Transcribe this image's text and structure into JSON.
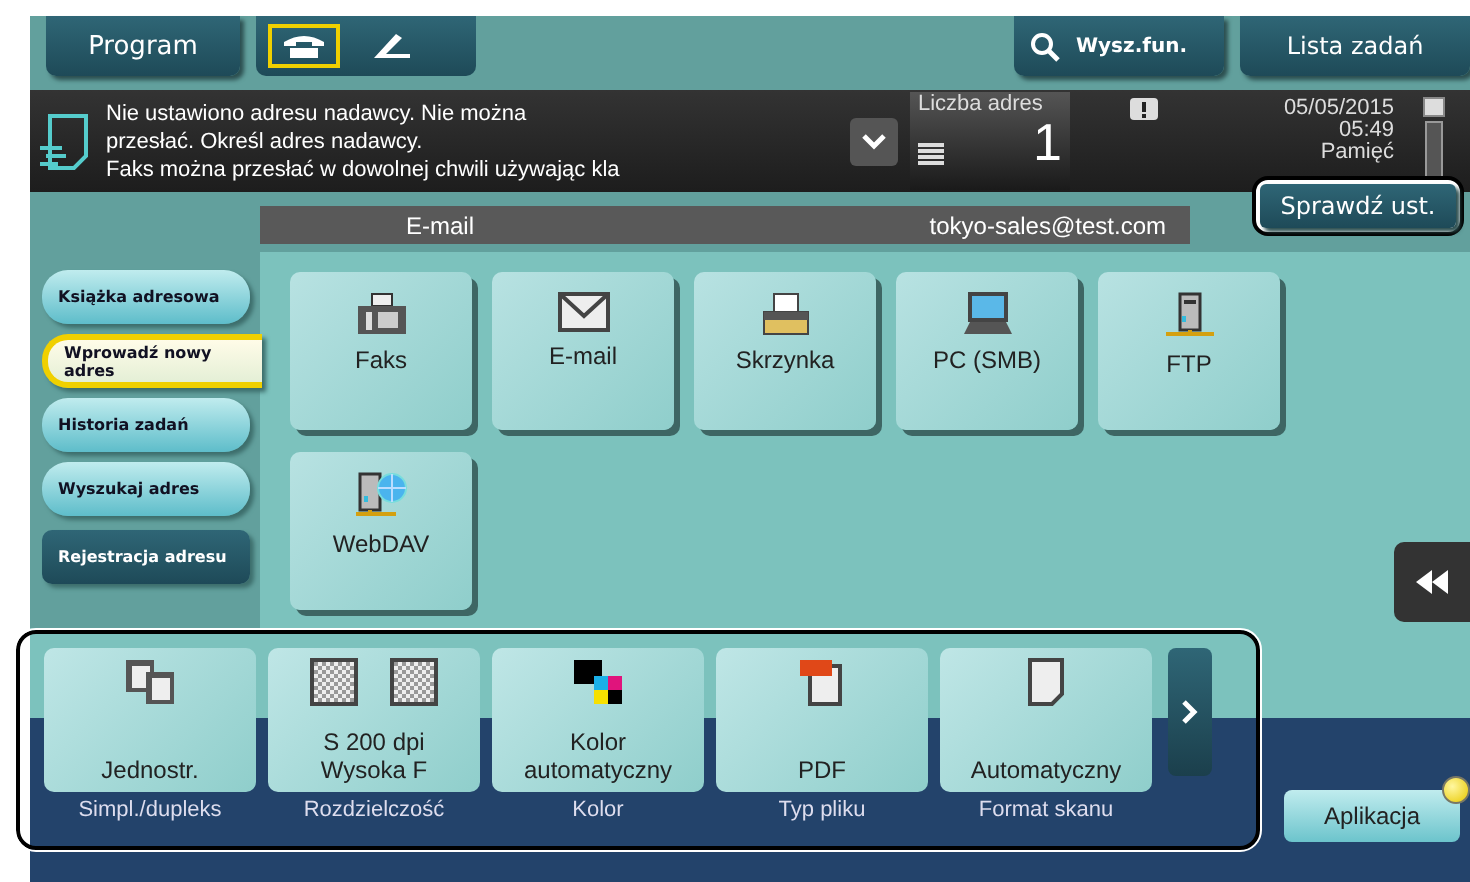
{
  "top_bar": {
    "program_button": "Program",
    "line_tabs": [
      {
        "kind": "phone",
        "selected": true
      },
      {
        "kind": "handset",
        "selected": false
      }
    ],
    "search_button": "Wysz.fun.",
    "job_list_button": "Lista zadań"
  },
  "message": {
    "text": "Nie ustawiono adresu nadawcy. Nie można\nprzesłać. Określ adres nadawcy.\nFaks można przesłać w dowolnej chwili używając kla",
    "address_count_label": "Liczba adres",
    "address_count": "1",
    "date": "05/05/2015",
    "time": "05:49",
    "memory_label": "Pamięć"
  },
  "check_settings_button": "Sprawdź ust.",
  "destination": {
    "type": "E-mail",
    "address": "tokyo-sales@test.com"
  },
  "sidebar": {
    "items": [
      {
        "label": "Książka adresowa",
        "selected": false,
        "kind": "tab"
      },
      {
        "label": "Wprowadź nowy adres",
        "selected": true,
        "kind": "tab"
      },
      {
        "label": "Historia zadań",
        "selected": false,
        "kind": "tab"
      },
      {
        "label": "Wyszukaj adres",
        "selected": false,
        "kind": "tab"
      },
      {
        "label": "Rejestracja adresu",
        "selected": false,
        "kind": "action"
      }
    ]
  },
  "destination_types": [
    {
      "label": "Faks",
      "kind": "fax"
    },
    {
      "label": "E-mail",
      "kind": "email"
    },
    {
      "label": "Skrzynka",
      "kind": "box"
    },
    {
      "label": "PC (SMB)",
      "kind": "pc"
    },
    {
      "label": "FTP",
      "kind": "ftp"
    },
    {
      "label": "WebDAV",
      "kind": "webdav"
    }
  ],
  "settings": [
    {
      "value": "Jednostr.",
      "label": "Simpl./dupleks",
      "kind": "duplex"
    },
    {
      "value": "S 200 dpi\nWysoka F",
      "label": "Rozdzielczość",
      "kind": "resolution"
    },
    {
      "value": "Kolor\nautomatyczny",
      "label": "Kolor",
      "kind": "color"
    },
    {
      "value": "PDF",
      "label": "Typ pliku",
      "kind": "pdf"
    },
    {
      "value": "Automatyczny",
      "label": "Format skanu",
      "kind": "page"
    }
  ],
  "application_button": "Aplikacja"
}
